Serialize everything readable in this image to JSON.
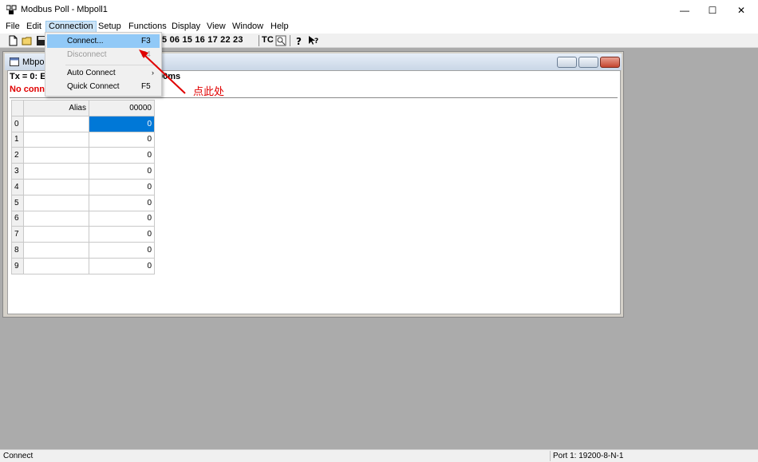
{
  "window": {
    "title": "Modbus Poll - Mbpoll1",
    "minimize": "—",
    "maximize": "☐",
    "close": "✕"
  },
  "menu": [
    "File",
    "Edit",
    "Connection",
    "Setup",
    "Functions",
    "Display",
    "View",
    "Window",
    "Help"
  ],
  "toolbar": {
    "func_codes": "5 06 15 16 17 22 23",
    "tc_label": "TC"
  },
  "connection_menu": {
    "connect": {
      "label": "Connect...",
      "shortcut": "F3"
    },
    "disconnect": {
      "label": "Disconnect",
      "shortcut": "F4"
    },
    "auto_connect": {
      "label": "Auto Connect",
      "arrow": "›"
    },
    "quick_connect": {
      "label": "Quick Connect",
      "shortcut": "F5"
    }
  },
  "child_window": {
    "title": "Mbpo",
    "tx_line": "Tx = 0: E",
    "tx_line_tail": "00ms",
    "status": "No conne"
  },
  "grid": {
    "alias_header": "Alias",
    "address_header": "00000",
    "rows": [
      {
        "index": "0",
        "value": "0"
      },
      {
        "index": "1",
        "value": "0"
      },
      {
        "index": "2",
        "value": "0"
      },
      {
        "index": "3",
        "value": "0"
      },
      {
        "index": "4",
        "value": "0"
      },
      {
        "index": "5",
        "value": "0"
      },
      {
        "index": "6",
        "value": "0"
      },
      {
        "index": "7",
        "value": "0"
      },
      {
        "index": "8",
        "value": "0"
      },
      {
        "index": "9",
        "value": "0"
      }
    ]
  },
  "annotation": {
    "text": "点此处",
    "color": "#e00000"
  },
  "statusbar": {
    "left": "Connect",
    "right": "Port 1: 19200-8-N-1"
  },
  "colors": {
    "selection": "#0078d7",
    "menu_hover": "#91c9f7",
    "error": "#e00000",
    "workspace": "#ababab"
  }
}
